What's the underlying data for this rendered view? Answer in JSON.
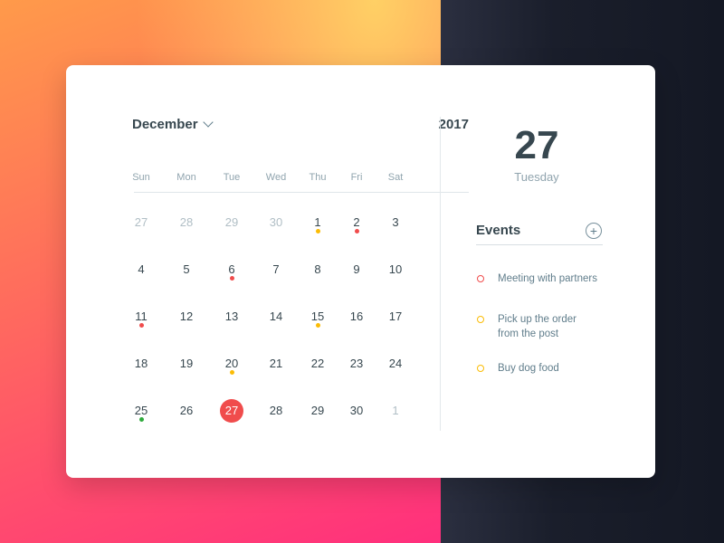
{
  "calendar": {
    "month": "December",
    "year": "2017",
    "weekdays": [
      "Sun",
      "Mon",
      "Tue",
      "Wed",
      "Thu",
      "Fri",
      "Sat"
    ],
    "weeks": [
      [
        {
          "d": "27",
          "other": true
        },
        {
          "d": "28",
          "other": true
        },
        {
          "d": "29",
          "other": true
        },
        {
          "d": "30",
          "other": true
        },
        {
          "d": "1",
          "dot": "#fbbc05"
        },
        {
          "d": "2",
          "dot": "#f04c4c"
        },
        {
          "d": "3"
        }
      ],
      [
        {
          "d": "4"
        },
        {
          "d": "5"
        },
        {
          "d": "6",
          "dot": "#f04c4c"
        },
        {
          "d": "7"
        },
        {
          "d": "8"
        },
        {
          "d": "9"
        },
        {
          "d": "10"
        }
      ],
      [
        {
          "d": "11",
          "dot": "#f04c4c"
        },
        {
          "d": "12"
        },
        {
          "d": "13"
        },
        {
          "d": "14"
        },
        {
          "d": "15",
          "dot": "#fbbc05"
        },
        {
          "d": "16"
        },
        {
          "d": "17"
        }
      ],
      [
        {
          "d": "18"
        },
        {
          "d": "19"
        },
        {
          "d": "20",
          "dot": "#fbbc05"
        },
        {
          "d": "21"
        },
        {
          "d": "22"
        },
        {
          "d": "23"
        },
        {
          "d": "24"
        }
      ],
      [
        {
          "d": "25",
          "dot": "#2eaa3c"
        },
        {
          "d": "26"
        },
        {
          "d": "27",
          "selected": true
        },
        {
          "d": "28"
        },
        {
          "d": "29"
        },
        {
          "d": "30"
        },
        {
          "d": "1",
          "other": true
        }
      ]
    ]
  },
  "selected": {
    "day": "27",
    "weekday": "Tuesday"
  },
  "events": {
    "title": "Events",
    "add_label": "+",
    "items": [
      {
        "text": "Meeting with partners",
        "color": "#f04c4c"
      },
      {
        "text": "Pick up the order from the post",
        "color": "#fbbc05"
      },
      {
        "text": "Buy dog food",
        "color": "#fbbc05"
      }
    ]
  },
  "colors": {
    "selected": "#f04c4c",
    "red": "#f04c4c",
    "yellow": "#fbbc05",
    "green": "#2eaa3c"
  }
}
